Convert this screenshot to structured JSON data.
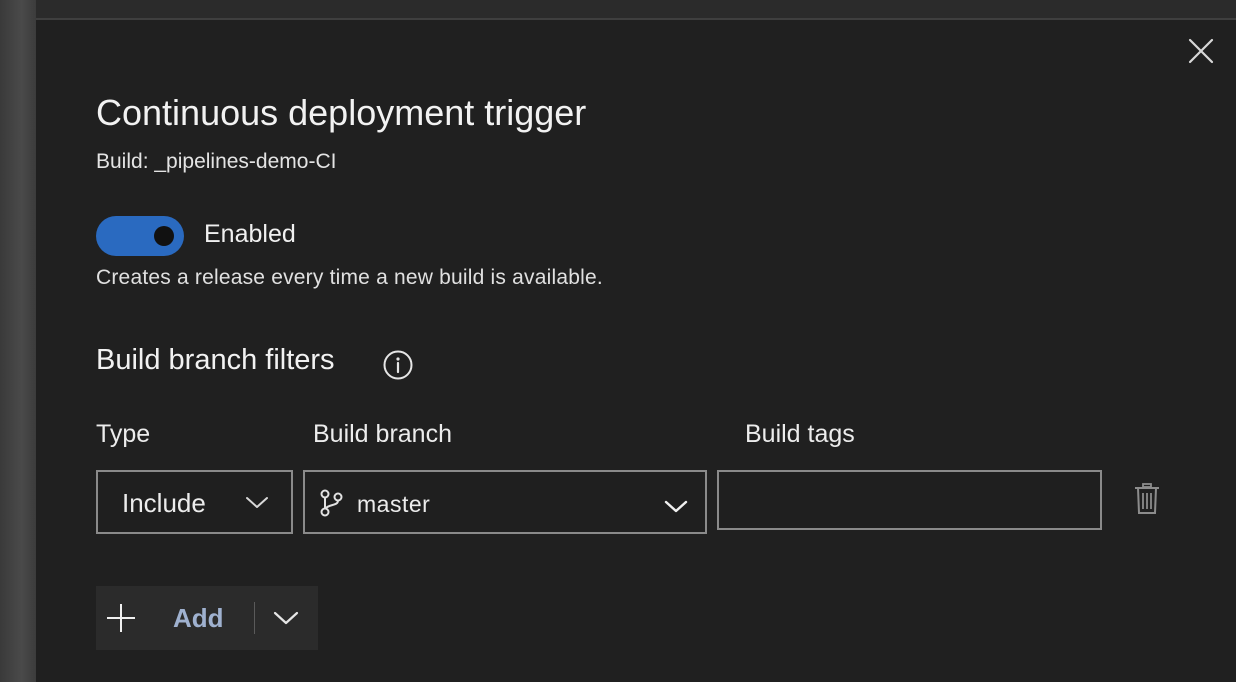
{
  "dialog": {
    "title": "Continuous deployment trigger",
    "subtitle": "Build: _pipelines-demo-CI",
    "close_icon": "close-icon"
  },
  "trigger": {
    "enabled": true,
    "toggle_label": "Enabled",
    "description": "Creates a release every time a new build is available.",
    "accent_color": "#2a6ac0"
  },
  "filters": {
    "section_title": "Build branch filters",
    "info_icon": "info-icon",
    "columns": {
      "type": "Type",
      "branch": "Build branch",
      "tags": "Build tags"
    },
    "rows": [
      {
        "type": "Include",
        "branch": "master",
        "tags": ""
      }
    ],
    "delete_icon": "trash-icon"
  },
  "actions": {
    "add_label": "Add",
    "add_icon": "plus-icon",
    "dropdown_icon": "chevron-down-icon"
  }
}
